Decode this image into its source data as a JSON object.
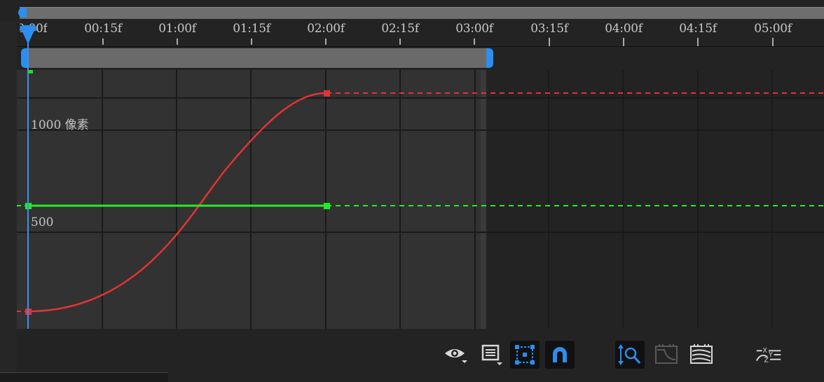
{
  "ruler": {
    "labels": [
      "0:00f",
      "00:15f",
      "01:00f",
      "01:15f",
      "02:00f",
      "02:15f",
      "03:00f",
      "03:15f",
      "04:00f",
      "04:15f",
      "05:00f"
    ]
  },
  "graph": {
    "value_labels": [
      "1000 像素",
      "500"
    ]
  },
  "colors": {
    "accent": "#2b8ef0",
    "red_curve": "#e53333",
    "green_curve": "#22ee22",
    "grid": "#1a1a1a"
  },
  "toolbar": {
    "icons": [
      "eye-icon",
      "list-icon",
      "transform-box-icon",
      "snap-magnet-icon",
      "zoom-fit-icon",
      "graph-fit-icon",
      "curves-icon",
      "separate-dimensions-icon"
    ]
  }
}
